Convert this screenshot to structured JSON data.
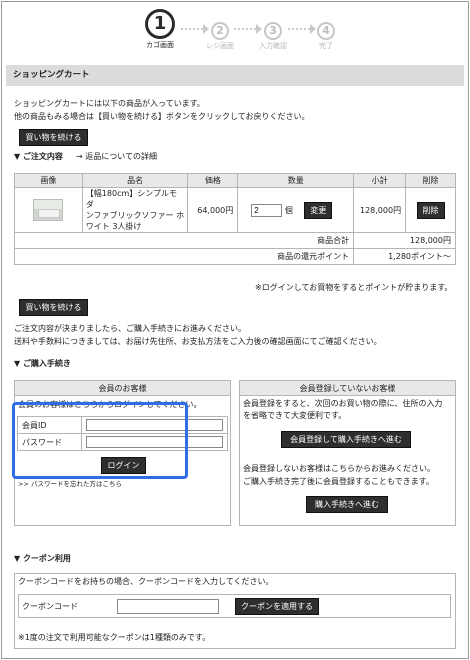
{
  "steps": [
    {
      "number": "1",
      "label": "カゴ画面",
      "active": true
    },
    {
      "number": "2",
      "label": "レジ画面",
      "active": false
    },
    {
      "number": "3",
      "label": "入力確認",
      "active": false
    },
    {
      "number": "4",
      "label": "完了",
      "active": false
    }
  ],
  "page_title": "ショッピングカート",
  "intro": {
    "line1": "ショッピングカートには以下の商品が入っています。",
    "line2": "他の商品もみる場合は【買い物を続ける】ボタンをクリックしてお戻りください。"
  },
  "continue_button": "買い物を続ける",
  "order_section": {
    "heading": "▼ ご注文内容",
    "return_link": "→ 返品についての詳細"
  },
  "cart_table": {
    "headers": [
      "画像",
      "品名",
      "価格",
      "数量",
      "小計",
      "削除"
    ],
    "item": {
      "name_line1": "【幅180cm】シンプルモダ",
      "name_line2": "ンファブリックソファー ホ",
      "name_line3": "ワイト 3人掛け",
      "price": "64,000円",
      "quantity": "2",
      "quantity_unit": "個",
      "change_button": "変更",
      "subtotal": "128,000円",
      "delete_button": "削除"
    },
    "total_label": "商品合計",
    "total_value": "128,000円",
    "points_label": "商品の還元ポイント",
    "points_value": "1,280ポイント〜"
  },
  "login_note": "※ログインしてお買物をするとポイントが貯まります。",
  "proceed_text": {
    "line1": "ご注文内容が決まりましたら、ご購入手続きにお進みください。",
    "line2": "送料や手数料につきましては、お届け先住所、お支払方法をご入力後の確認画面にてご確認ください。"
  },
  "purchase_heading": "▼ ご購入手続き",
  "member_panel": {
    "heading": "会員のお客様",
    "intro": "会員のお客様はこちらからログインしてください。",
    "id_label": "会員ID",
    "password_label": "パスワード",
    "login_button": "ログイン",
    "forgot_link": ">> パスワードを忘れた方はこちら"
  },
  "guest_panel": {
    "heading": "会員登録していないお客様",
    "text1": "会員登録をすると、次回のお買い物の際に、住所の入力",
    "text2": "を省略できて大変便利です。",
    "register_button": "会員登録して購入手続きへ進む",
    "text3": "会員登録しないお客様はこちらからお進みください。",
    "text4": "ご購入手続き完了後に会員登録することもできます。",
    "proceed_button": "購入手続きへ進む"
  },
  "coupon": {
    "heading": "▼ クーポン利用",
    "intro": "クーポンコードをお持ちの場合、クーポンコードを入力してください。",
    "label": "クーポンコード",
    "apply_button": "クーポンを適用する",
    "note": "※1度の注文で利用可能なクーポンは1種類のみです。"
  }
}
